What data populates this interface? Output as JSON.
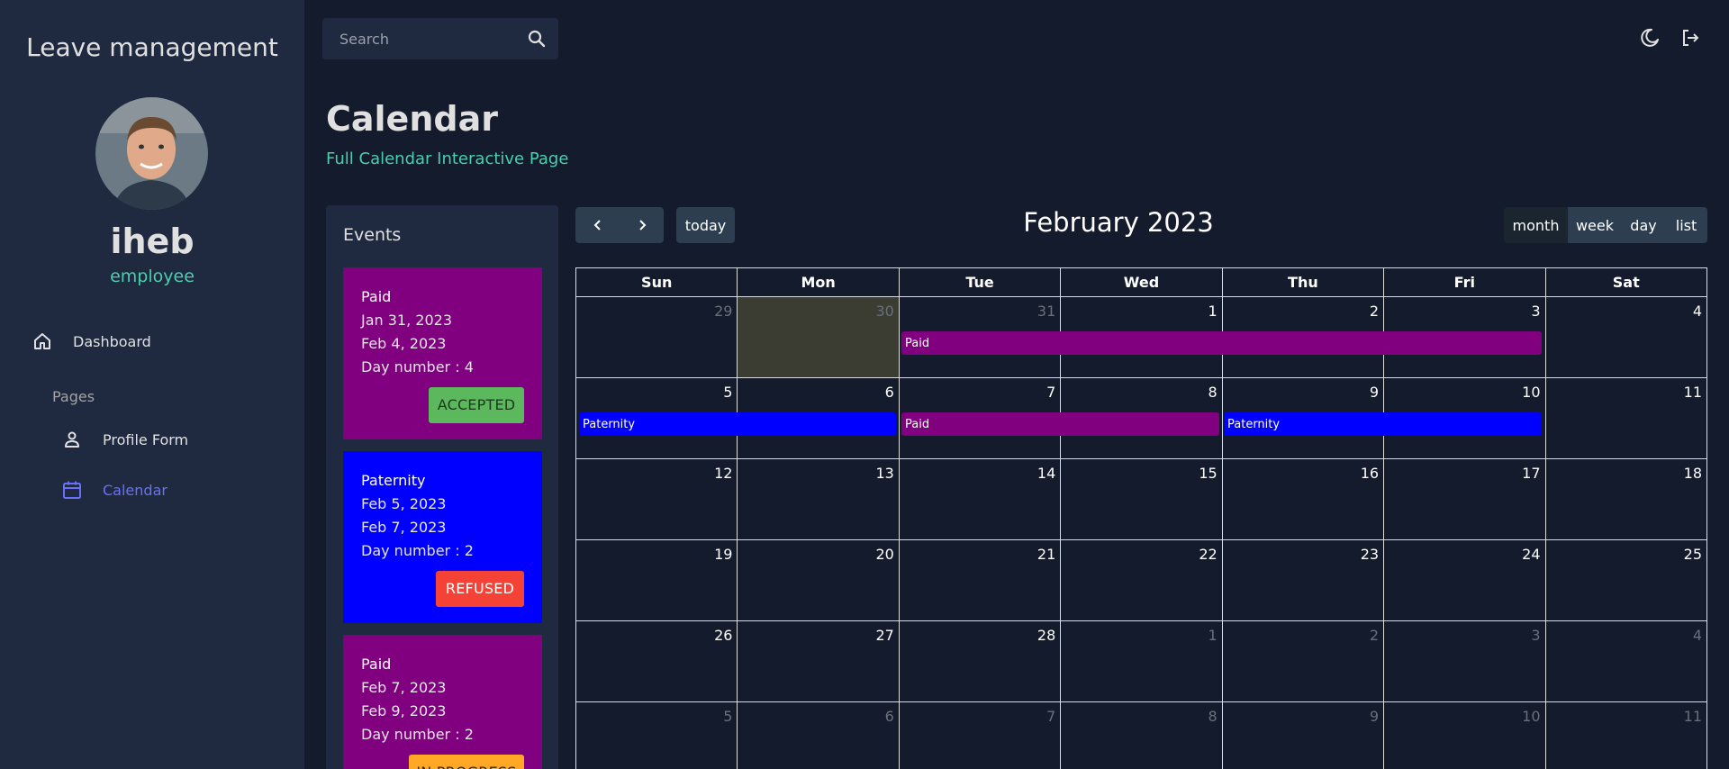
{
  "sidebar": {
    "app_title": "Leave management",
    "user_name": "iheb",
    "user_role": "employee",
    "nav_dashboard": "Dashboard",
    "section_pages": "Pages",
    "nav_profile": "Profile Form",
    "nav_calendar": "Calendar",
    "active_color": "#6870fa"
  },
  "topbar": {
    "search_placeholder": "Search"
  },
  "header": {
    "title": "Calendar",
    "subtitle": "Full Calendar Interactive Page"
  },
  "events": {
    "title": "Events",
    "items": [
      {
        "type": "Paid",
        "start": "Jan 31, 2023",
        "end": "Feb 4, 2023",
        "days": "Day number : 4",
        "status": "ACCEPTED",
        "color": "#800080",
        "status_color": "#5cb85c"
      },
      {
        "type": "Paternity",
        "start": "Feb 5, 2023",
        "end": "Feb 7, 2023",
        "days": "Day number : 2",
        "status": "REFUSED",
        "color": "#0000ff",
        "status_color": "#f44336"
      },
      {
        "type": "Paid",
        "start": "Feb 7, 2023",
        "end": "Feb 9, 2023",
        "days": "Day number : 2",
        "status": "IN PROGRESS",
        "color": "#800080",
        "status_color": "#ffa726"
      }
    ]
  },
  "toolbar": {
    "title": "February 2023",
    "today": "today",
    "views": [
      "month",
      "week",
      "day",
      "list"
    ],
    "active_view": "month"
  },
  "calendar": {
    "weekdays": [
      "Sun",
      "Mon",
      "Tue",
      "Wed",
      "Thu",
      "Fri",
      "Sat"
    ],
    "weeks": [
      [
        "29",
        "30",
        "31",
        "1",
        "2",
        "3",
        "4"
      ],
      [
        "5",
        "6",
        "7",
        "8",
        "9",
        "10",
        "11"
      ],
      [
        "12",
        "13",
        "14",
        "15",
        "16",
        "17",
        "18"
      ],
      [
        "19",
        "20",
        "21",
        "22",
        "23",
        "24",
        "25"
      ],
      [
        "26",
        "27",
        "28",
        "1",
        "2",
        "3",
        "4"
      ],
      [
        "5",
        "6",
        "7",
        "8",
        "9",
        "10",
        "11"
      ]
    ],
    "today_marker": "Jan 30",
    "bars": [
      {
        "label": "Paid",
        "color": "#800080"
      },
      {
        "label": "Paternity",
        "color": "#0000ff"
      },
      {
        "label": "Paid",
        "color": "#800080"
      },
      {
        "label": "Paternity",
        "color": "#0000ff"
      }
    ]
  }
}
